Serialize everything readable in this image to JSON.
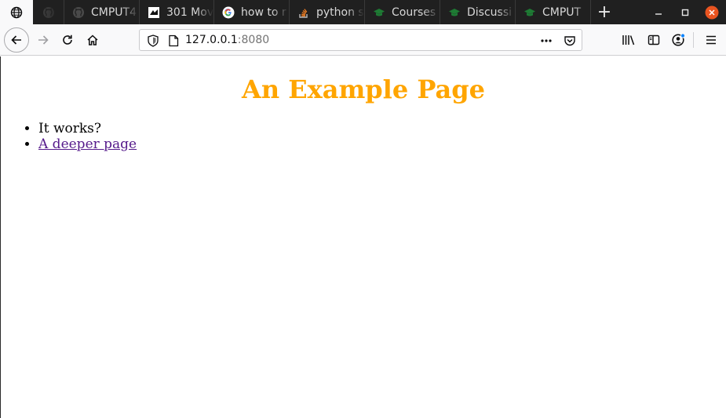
{
  "browser": {
    "tabs": [
      {
        "label": "",
        "icon": "globe-icon",
        "state": "selected"
      },
      {
        "label": "",
        "icon": "github-icon",
        "state": "pinned"
      },
      {
        "label": "CMPUT4",
        "icon": "github-icon",
        "state": "inactive"
      },
      {
        "label": "301 Mov",
        "icon": "page-favicon-icon",
        "state": "inactive"
      },
      {
        "label": "how to r",
        "icon": "google-icon",
        "state": "inactive"
      },
      {
        "label": "python s",
        "icon": "stackoverflow-icon",
        "state": "inactive"
      },
      {
        "label": "Courses",
        "icon": "graduation-cap-icon",
        "state": "inactive"
      },
      {
        "label": "Discussi",
        "icon": "graduation-cap-icon",
        "state": "inactive"
      },
      {
        "label": "CMPUT",
        "icon": "graduation-cap-icon",
        "state": "inactive"
      }
    ],
    "new_tab_label": "+",
    "url": {
      "host": "127.0.0.1",
      "port": ":8080"
    },
    "colors": {
      "tabstrip": "#202020",
      "toolbar": "#f9f9fa",
      "close_button": "#e95420",
      "notification_dot": "#0a84ff"
    }
  },
  "page": {
    "heading": "An Example Page",
    "heading_color": "#ffa500",
    "list_items": [
      {
        "text": "It works?",
        "link": false
      },
      {
        "text": "A deeper page",
        "link": true
      }
    ]
  }
}
